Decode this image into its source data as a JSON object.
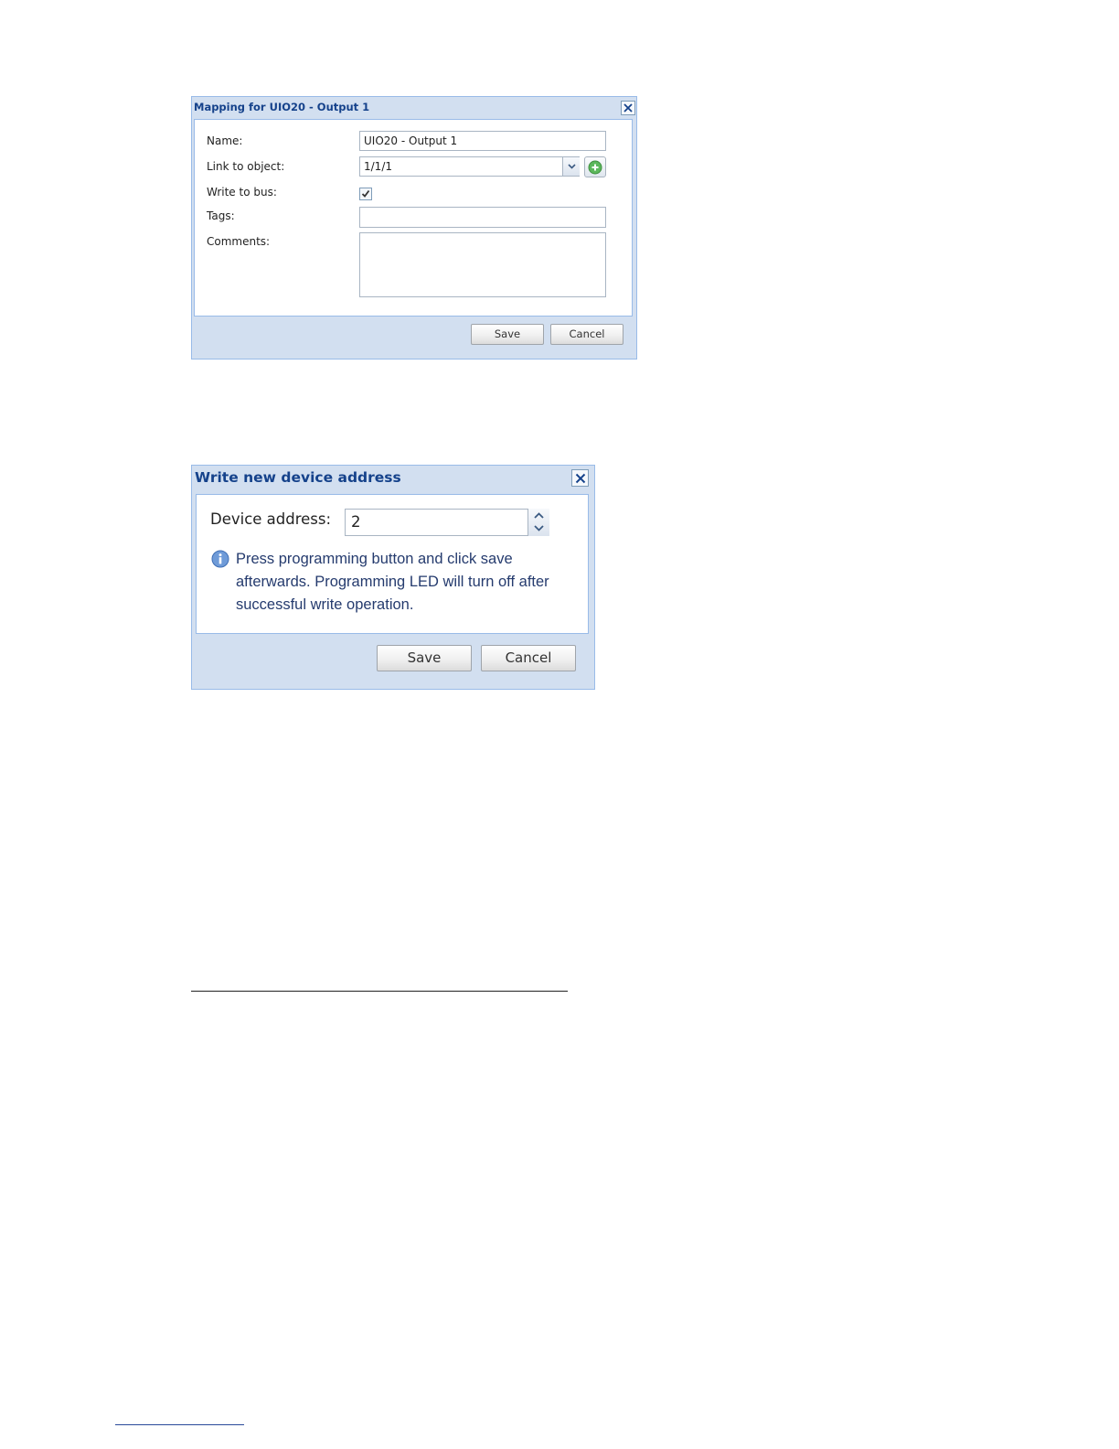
{
  "mapping_dialog": {
    "title": "Mapping for UIO20 - Output 1",
    "name_label": "Name:",
    "name_value": "UIO20 - Output 1",
    "link_label": "Link to object:",
    "link_value": "1/1/1",
    "write_label": "Write to bus:",
    "write_checked": true,
    "tags_label": "Tags:",
    "tags_value": "",
    "comments_label": "Comments:",
    "comments_value": "",
    "save_label": "Save",
    "cancel_label": "Cancel",
    "icons": [
      "close-icon",
      "chevron-down-icon",
      "add-icon",
      "checkmark-icon"
    ]
  },
  "address_dialog": {
    "title": "Write new device address",
    "address_label": "Device address:",
    "address_value": "2",
    "info_text": "Press programming button and click save afterwards. Programming LED will turn off after successful write operation.",
    "save_label": "Save",
    "cancel_label": "Cancel",
    "icons": [
      "close-icon",
      "spinner-up-icon",
      "spinner-down-icon",
      "info-icon"
    ]
  },
  "colors": {
    "window_frame": "#d2dff0",
    "window_border": "#99bbe8",
    "title_text": "#15428b",
    "info_text": "#253b6e",
    "add_icon_green": "#5cb85c"
  }
}
